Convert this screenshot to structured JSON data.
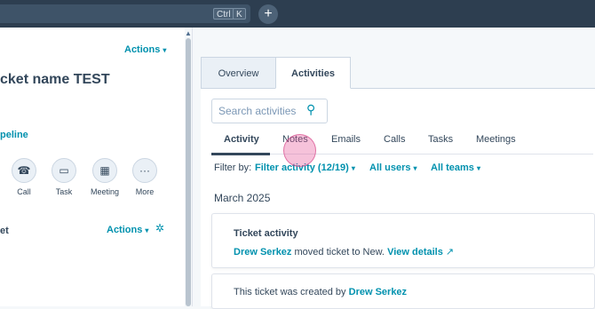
{
  "topbar": {
    "ctrl_key": "Ctrl",
    "k_key": "K",
    "new_tab": "+"
  },
  "left": {
    "actions_top": "Actions",
    "title": "cket name TEST",
    "pipeline": "peline",
    "quick_actions": [
      {
        "label": "Call",
        "icon": "phone-icon",
        "glyph": "☎"
      },
      {
        "label": "Task",
        "icon": "task-icon",
        "glyph": "▭"
      },
      {
        "label": "Meeting",
        "icon": "calendar-icon",
        "glyph": "▦"
      },
      {
        "label": "More",
        "icon": "more-icon",
        "glyph": "···"
      }
    ],
    "section_label": "et",
    "section_actions": "Actions"
  },
  "tabs": [
    {
      "label": "Overview"
    },
    {
      "label": "Activities"
    }
  ],
  "search": {
    "placeholder": "Search activities"
  },
  "subtabs": [
    "Activity",
    "Notes",
    "Emails",
    "Calls",
    "Tasks",
    "Meetings"
  ],
  "filter": {
    "label": "Filter by:",
    "activity": "Filter activity (12/19)",
    "users": "All users",
    "teams": "All teams"
  },
  "month": "March 2025",
  "cards": {
    "activity": {
      "title": "Ticket activity",
      "user": "Drew Serkez",
      "text": "moved ticket to New.",
      "link": "View details"
    },
    "created": {
      "text": "This ticket was created by",
      "user": "Drew Serkez"
    }
  },
  "colors": {
    "accent": "#0091ae",
    "topbar": "#2d3e50",
    "text": "#33475b"
  }
}
